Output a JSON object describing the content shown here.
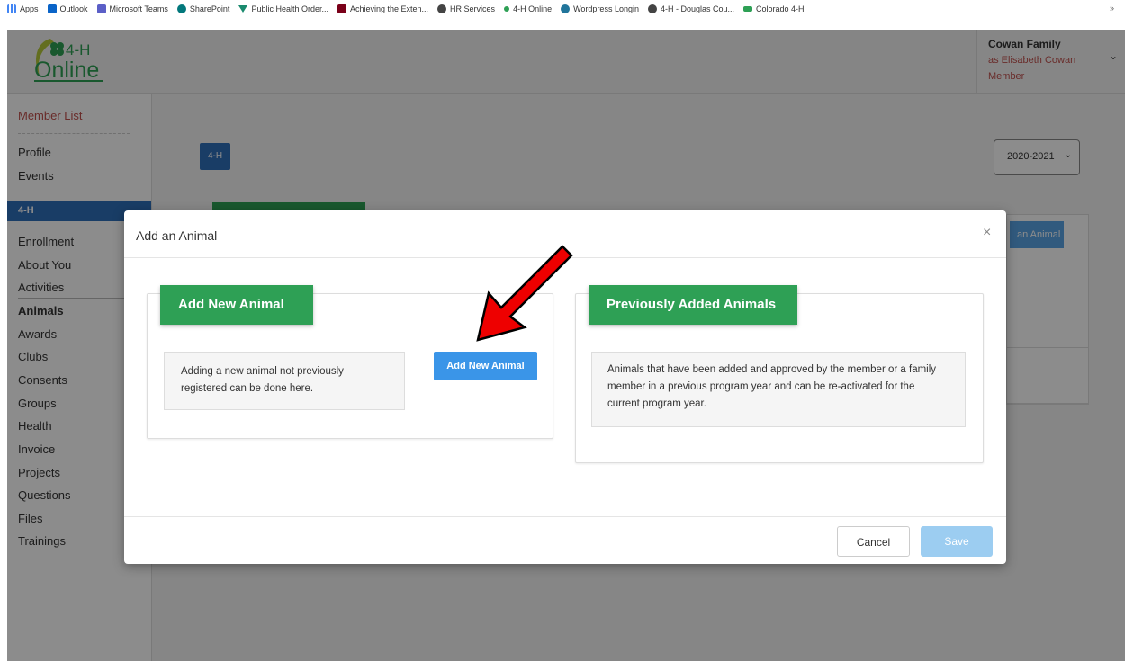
{
  "bookmarks": {
    "items": [
      {
        "label": "Apps",
        "icon": "apps-grid-icon"
      },
      {
        "label": "Outlook",
        "icon": "outlook-icon"
      },
      {
        "label": "Microsoft Teams",
        "icon": "teams-icon"
      },
      {
        "label": "SharePoint",
        "icon": "sharepoint-icon"
      },
      {
        "label": "Public Health Order...",
        "icon": "public-health-icon"
      },
      {
        "label": "Achieving the Exten...",
        "icon": "university-icon"
      },
      {
        "label": "HR Services",
        "icon": "globe-icon"
      },
      {
        "label": "4-H Online",
        "icon": "clover-icon"
      },
      {
        "label": "Wordpress Longin",
        "icon": "wordpress-icon"
      },
      {
        "label": "4-H - Douglas Cou...",
        "icon": "globe-icon"
      },
      {
        "label": "Colorado 4-H",
        "icon": "colorado-icon"
      }
    ],
    "more": "»"
  },
  "header": {
    "logo_text_top": "4-H",
    "logo_text_bottom": "Online",
    "user_name": "Cowan Family",
    "user_as": "as Elisabeth Cowan",
    "user_role": "Member"
  },
  "sidebar": {
    "member_list": "Member List",
    "profile": "Profile",
    "events": "Events",
    "section_label": "4-H",
    "items": [
      "Enrollment",
      "About You",
      "Activities",
      "Animals",
      "Awards",
      "Clubs",
      "Consents",
      "Groups",
      "Health",
      "Invoice",
      "Projects",
      "Questions",
      "Files",
      "Trainings"
    ],
    "active_item": "Animals"
  },
  "main": {
    "program_button": "4-H",
    "year_select": "2020-2021",
    "add_animal_bg": "an Animal"
  },
  "modal": {
    "title": "Add an Animal",
    "close": "×",
    "left_card": {
      "tab": "Add New Animal",
      "text": "Adding a new animal not previously registered can be done here.",
      "button": "Add New Animal"
    },
    "right_card": {
      "tab": "Previously Added Animals",
      "text": "Animals that have been added and approved by the member or a family member in a previous program year and can be re-activated for the current program year."
    },
    "cancel": "Cancel",
    "save": "Save"
  },
  "colors": {
    "brand_green": "#2ea055",
    "primary_blue": "#3a95e8",
    "nav_blue": "#2f6fba",
    "accent_red": "#c0504d",
    "annotation_arrow": "#ee0000"
  }
}
